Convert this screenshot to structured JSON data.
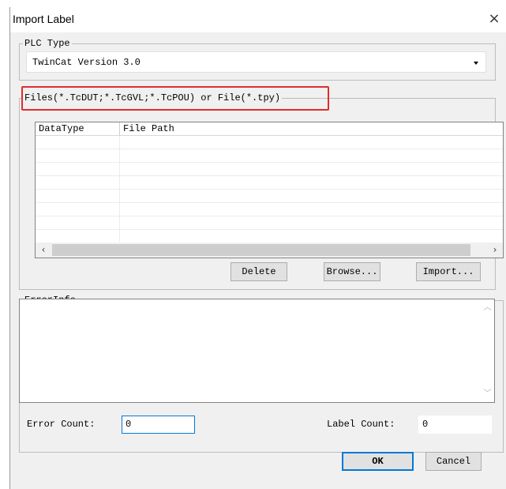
{
  "window": {
    "title": "Import Label",
    "close_glyph": "×"
  },
  "plc_type": {
    "legend": "PLC Type",
    "selected": "TwinCat Version 3.0"
  },
  "files": {
    "legend": "Files(*.TcDUT;*.TcGVL;*.TcPOU) or File(*.tpy)",
    "columns": [
      "DataType",
      "File Path"
    ],
    "rows": []
  },
  "buttons": {
    "delete": "Delete",
    "browse": "Browse...",
    "import": "Import...",
    "ok": "OK",
    "cancel": "Cancel"
  },
  "error_info": {
    "legend": "ErrorInfo",
    "text": ""
  },
  "counts": {
    "error_count_label": "Error Count:",
    "error_count_value": "0",
    "label_count_label": "Label Count:",
    "label_count_value": "0"
  },
  "icons": {
    "scroll_left": "‹",
    "scroll_right": "›",
    "scroll_up": "︿",
    "scroll_down": "﹀"
  },
  "colors": {
    "highlight": "#e02b2b",
    "focus": "#0078d7"
  }
}
